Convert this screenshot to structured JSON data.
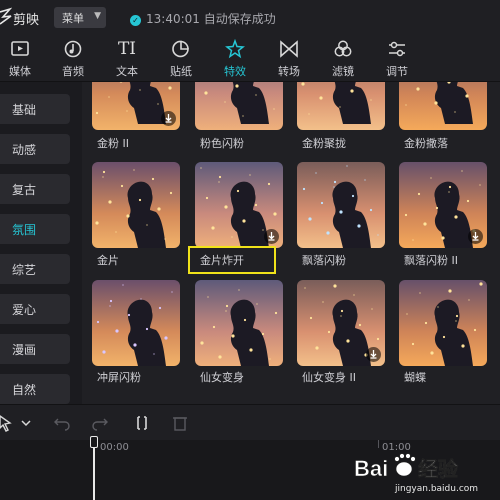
{
  "app": {
    "name": "剪映",
    "menu_label": "菜单",
    "save_time": "13:40:01",
    "save_text": "自动保存成功"
  },
  "toolbar": {
    "items": [
      {
        "label": "媒体",
        "icon": "media-icon"
      },
      {
        "label": "音频",
        "icon": "audio-icon"
      },
      {
        "label": "文本",
        "icon": "text-icon"
      },
      {
        "label": "贴纸",
        "icon": "sticker-icon"
      },
      {
        "label": "特效",
        "icon": "effects-icon",
        "active": true
      },
      {
        "label": "转场",
        "icon": "transition-icon"
      },
      {
        "label": "滤镜",
        "icon": "filter-icon"
      },
      {
        "label": "调节",
        "icon": "adjust-icon"
      }
    ],
    "text_glyph": "TI",
    "accent": "#26c6d4"
  },
  "sidebar": {
    "items": [
      {
        "label": "基础"
      },
      {
        "label": "动感"
      },
      {
        "label": "复古"
      },
      {
        "label": "氛围",
        "active": true
      },
      {
        "label": "综艺"
      },
      {
        "label": "爱心"
      },
      {
        "label": "漫画"
      },
      {
        "label": "自然"
      }
    ]
  },
  "effects": {
    "rows": [
      [
        "金粉 II",
        "粉色闪粉",
        "金粉聚拢",
        "金粉撒落"
      ],
      [
        "金片",
        "金片炸开",
        "飘落闪粉",
        "飘落闪粉 II"
      ],
      [
        "冲屏闪粉",
        "仙女变身",
        "仙女变身 II",
        "蝴蝶"
      ]
    ],
    "highlighted": "金片炸开",
    "highlight_color": "#f0e21a"
  },
  "timeline": {
    "marks": [
      "00:00",
      "01:00"
    ]
  },
  "watermark": {
    "text": "Bai 经验",
    "sub": "jingyan.baidu.com"
  }
}
